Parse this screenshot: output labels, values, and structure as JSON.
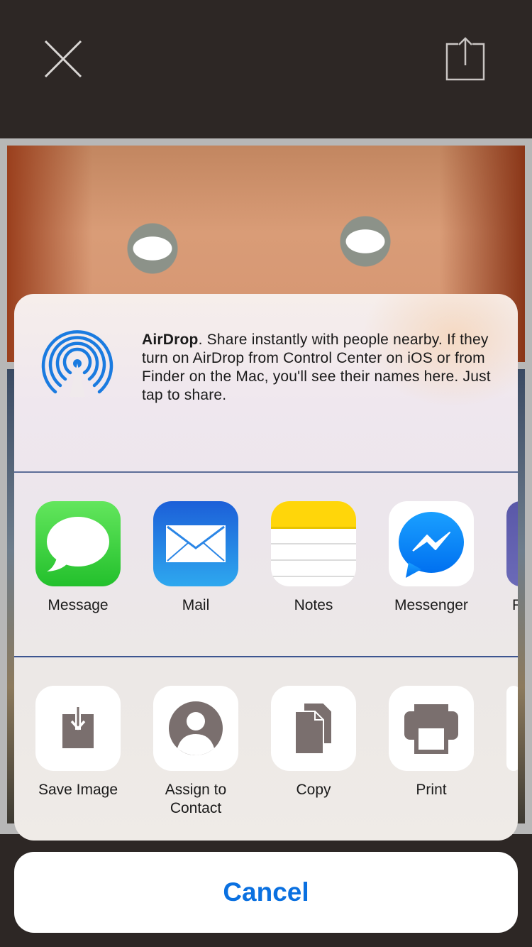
{
  "topbar": {
    "close_icon": "close-icon",
    "share_icon": "share-icon"
  },
  "airdrop": {
    "icon": "airdrop-icon",
    "title": "AirDrop",
    "description": ". Share instantly with people nearby. If they turn on AirDrop from Control Center on iOS or from Finder on the Mac, you'll see their names here. Just tap to share."
  },
  "apps": [
    {
      "label": "Message",
      "icon": "message-icon"
    },
    {
      "label": "Mail",
      "icon": "mail-icon"
    },
    {
      "label": "Notes",
      "icon": "notes-icon"
    },
    {
      "label": "Messenger",
      "icon": "messenger-icon"
    },
    {
      "label": "F",
      "icon": "partial-app-icon"
    }
  ],
  "actions": [
    {
      "label": "Save Image",
      "icon": "save-image-icon"
    },
    {
      "label": "Assign to Contact",
      "icon": "contact-icon"
    },
    {
      "label": "Copy",
      "icon": "copy-icon"
    },
    {
      "label": "Print",
      "icon": "print-icon"
    }
  ],
  "cancel": {
    "label": "Cancel"
  },
  "colors": {
    "accent": "#0a70e0",
    "topbar": "#2d2725",
    "airdrop_blue": "#1a7be0",
    "action_icon_gray": "#7a6f6e"
  }
}
